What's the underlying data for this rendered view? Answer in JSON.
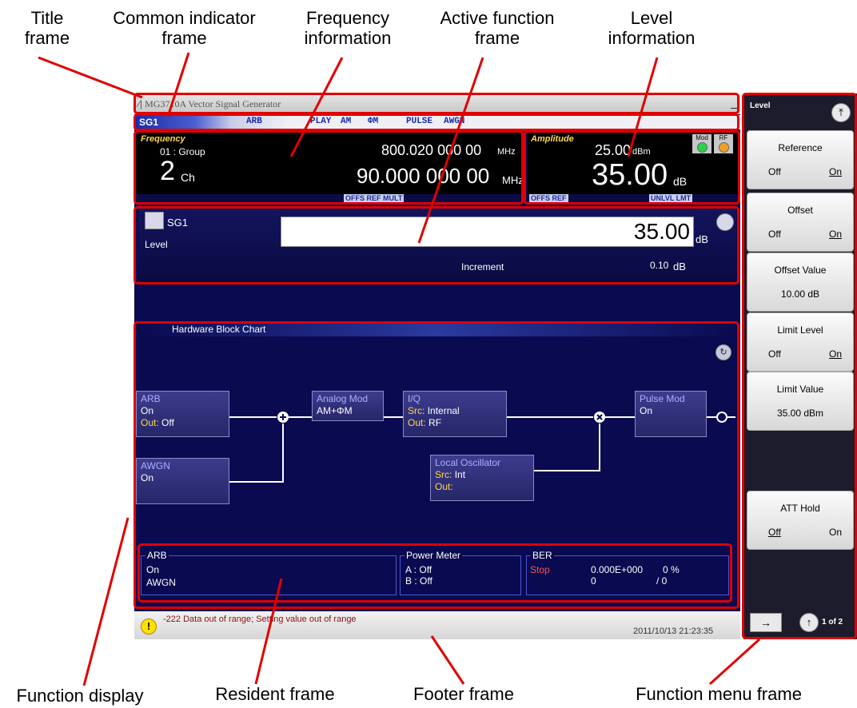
{
  "callouts": {
    "title_frame": "Title\nframe",
    "common_indicator": "Common indicator\nframe",
    "frequency_info": "Frequency\ninformation",
    "active_function": "Active function\nframe",
    "level_info": "Level\ninformation",
    "function_display": "Function display",
    "resident_frame": "Resident frame",
    "footer_frame": "Footer frame",
    "function_menu": "Function menu frame"
  },
  "titlebar": {
    "text": "MG3710A  Vector Signal Generator",
    "minimize": "_"
  },
  "indicator": {
    "sg": "SG1",
    "items": [
      "ARB",
      "PLAY",
      "AM",
      "ΦM",
      "PULSE",
      "AWGN"
    ]
  },
  "frequency": {
    "label": "Frequency",
    "group": "01 : Group",
    "channel": "2",
    "channel_unit": "Ch",
    "small_value": "800.020 000 00",
    "small_unit": "MHz",
    "big_value": "90.000 000 00",
    "big_unit": "MHz",
    "tags": "OFFS REF MULT"
  },
  "amplitude": {
    "label": "Amplitude",
    "small_value": "25.00",
    "small_unit": "dBm",
    "big_value": "35.00",
    "big_unit": "dB",
    "mod": "Mod",
    "rf": "RF",
    "tags_left": "OFFS REF",
    "tags_right": "UNLVL LMT"
  },
  "active_function": {
    "sg": "SG1",
    "name": "Level",
    "value": "35.00",
    "unit": "dB",
    "increment_label": "Increment",
    "increment_value": "0.10",
    "increment_unit": "dB"
  },
  "block_chart": {
    "title": "Hardware Block Chart",
    "arb": {
      "title": "ARB",
      "state": "On",
      "out_label": "Out:",
      "out_value": "Off"
    },
    "awgn": {
      "title": "AWGN",
      "state": "On"
    },
    "analog": {
      "title": "Analog Mod",
      "value": "AM+ΦM"
    },
    "iq": {
      "title": "I/Q",
      "src_label": "Src:",
      "src_value": "Internal",
      "out_label": "Out:",
      "out_value": "RF"
    },
    "lo": {
      "title": "Local Oscillator",
      "src_label": "Src:",
      "src_value": "Int",
      "out_label": "Out:"
    },
    "pulse": {
      "title": "Pulse Mod",
      "state": "On"
    }
  },
  "resident": {
    "arb": {
      "title": "ARB",
      "line1": "On",
      "line2": "AWGN"
    },
    "power_meter": {
      "title": "Power Meter",
      "a_label": "A :",
      "a_value": "Off",
      "b_label": "B :",
      "b_value": "Off"
    },
    "ber": {
      "title": "BER",
      "status": "Stop",
      "value1": "0.000E+000",
      "value2": "0 %",
      "value3": "0",
      "value4": "/ 0"
    }
  },
  "footer": {
    "message": "-222 Data out of range; Setting value out of range",
    "datetime": "2011/10/13 21:23:35"
  },
  "menu": {
    "title": "Level",
    "buttons": [
      {
        "title": "Reference",
        "left": "Off",
        "right": "On"
      },
      {
        "title": "Offset",
        "left": "Off",
        "right": "On"
      },
      {
        "title": "Offset Value",
        "value": "10.00 dB"
      },
      {
        "title": "Limit Level",
        "left": "Off",
        "right": "On"
      },
      {
        "title": "Limit Value",
        "value": "35.00 dBm"
      },
      {
        "title": "ATT Hold",
        "left": "Off",
        "right": "On"
      }
    ],
    "page": "1 of 2"
  },
  "colors": {
    "annotation": "#e00000",
    "screen_bg": "#0a0a50",
    "status_yellow": "#ffd84a",
    "error_text": "#8b1010"
  }
}
